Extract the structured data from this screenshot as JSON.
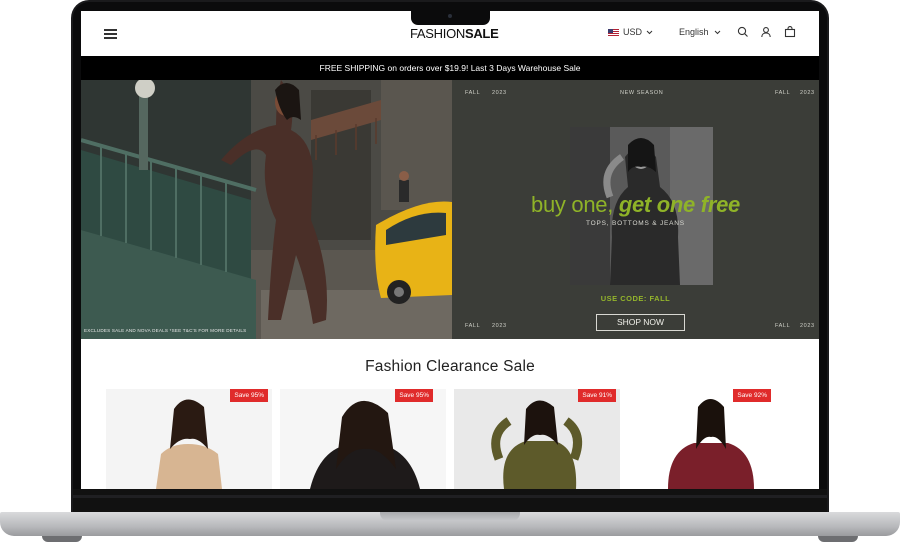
{
  "header": {
    "logo_thin": "FASHION",
    "logo_bold": "SALE",
    "currency": "USD",
    "language": "English"
  },
  "announcement": "FREE SHIPPING on orders over $19.9! Last 3 Days Warehouse Sale",
  "hero_left": {
    "disclaimer": "EXCLUDES SALE AND NOVA DEALS *SEE T&C'S FOR MORE DETAILS"
  },
  "hero_right": {
    "corners": {
      "top_left_a": "FALL",
      "top_left_b": "2023",
      "top_center": "NEW SEASON",
      "top_right_a": "FALL",
      "top_right_b": "2023",
      "bottom_left_a": "FALL",
      "bottom_left_b": "2023",
      "bottom_right_a": "FALL",
      "bottom_right_b": "2023"
    },
    "promo_plain": "buy one,",
    "promo_italic": "get one free",
    "subtitle": "TOPS, BOTTOMS & JEANS",
    "code": "USE CODE: FALL",
    "cta": "SHOP NOW"
  },
  "section": {
    "title": "Fashion Clearance Sale",
    "products": [
      {
        "badge": "Save 95%"
      },
      {
        "badge": "Save 95%"
      },
      {
        "badge": "Save 91%"
      },
      {
        "badge": "Save 92%"
      }
    ]
  },
  "colors": {
    "accent_green": "#8fb328",
    "badge_red": "#e02b2b",
    "announcement_bg": "#000000",
    "hero_right_bg": "#3b3d38"
  },
  "icons": [
    "menu-icon",
    "us-flag-icon",
    "chevron-down-icon",
    "search-icon",
    "user-icon",
    "bag-icon"
  ]
}
